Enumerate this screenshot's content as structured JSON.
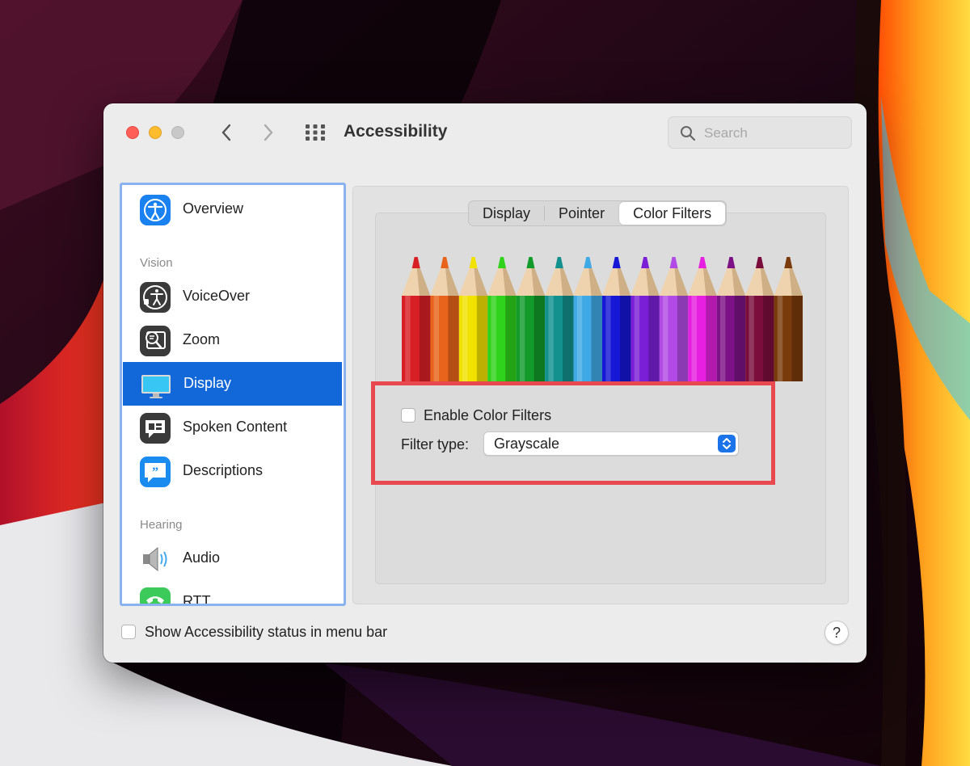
{
  "window": {
    "title": "Accessibility",
    "search_placeholder": "Search"
  },
  "sidebar": {
    "items": [
      {
        "label": "Overview",
        "icon": "accessibility-icon"
      },
      {
        "label": "VoiceOver",
        "icon": "voiceover-icon"
      },
      {
        "label": "Zoom",
        "icon": "zoom-icon"
      },
      {
        "label": "Display",
        "icon": "display-icon",
        "selected": true
      },
      {
        "label": "Spoken Content",
        "icon": "spoken-content-icon"
      },
      {
        "label": "Descriptions",
        "icon": "descriptions-icon"
      },
      {
        "label": "Audio",
        "icon": "speaker-icon"
      },
      {
        "label": "RTT",
        "icon": "rtt-phone-icon"
      }
    ],
    "sections": {
      "vision": "Vision",
      "hearing": "Hearing"
    }
  },
  "tabs": [
    {
      "label": "Display"
    },
    {
      "label": "Pointer"
    },
    {
      "label": "Color Filters",
      "active": true
    }
  ],
  "color_filters": {
    "enable_label": "Enable Color Filters",
    "enable_checked": false,
    "filter_type_label": "Filter type:",
    "filter_type_value": "Grayscale",
    "pencil_colors": [
      "#d91f26",
      "#e8641c",
      "#f2e200",
      "#2fd31c",
      "#129a2b",
      "#12918e",
      "#3fa9e6",
      "#1717d6",
      "#7a1fd6",
      "#b24be6",
      "#e61fe0",
      "#7d1287",
      "#7a0d3b",
      "#7a3b0c"
    ]
  },
  "footer": {
    "status_label": "Show Accessibility status in menu bar",
    "status_checked": false,
    "help_label": "?"
  },
  "colors": {
    "accent": "#1368d9",
    "highlight_box": "#e8484e",
    "sidebar_focus": "#8ab2ef"
  }
}
